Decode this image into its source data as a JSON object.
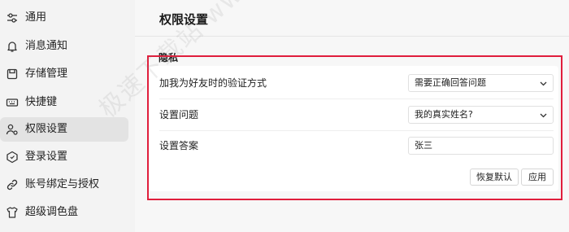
{
  "sidebar": {
    "items": [
      {
        "label": "通用",
        "icon": "sliders-icon"
      },
      {
        "label": "消息通知",
        "icon": "bell-icon"
      },
      {
        "label": "存储管理",
        "icon": "storage-icon"
      },
      {
        "label": "快捷键",
        "icon": "keyboard-icon"
      },
      {
        "label": "权限设置",
        "icon": "user-gear-icon",
        "active": true
      },
      {
        "label": "登录设置",
        "icon": "login-shield-icon"
      },
      {
        "label": "账号绑定与授权",
        "icon": "link-icon"
      },
      {
        "label": "超级调色盘",
        "icon": "tshirt-icon"
      }
    ]
  },
  "main": {
    "title": "权限设置",
    "section_title": "隐私",
    "rows": {
      "verify_label": "加我为好友时的验证方式",
      "verify_value": "需要正确回答问题",
      "question_label": "设置问题",
      "question_value": "我的真实姓名?",
      "answer_label": "设置答案",
      "answer_value": "张三"
    },
    "buttons": {
      "reset": "恢复默认",
      "apply": "应用"
    }
  },
  "watermark": "极速下载站 www.jisudown.com",
  "colors": {
    "highlight": "#e01e3c",
    "sidebar_bg": "#f3f3f3",
    "active_bg": "#e3e3e3"
  }
}
